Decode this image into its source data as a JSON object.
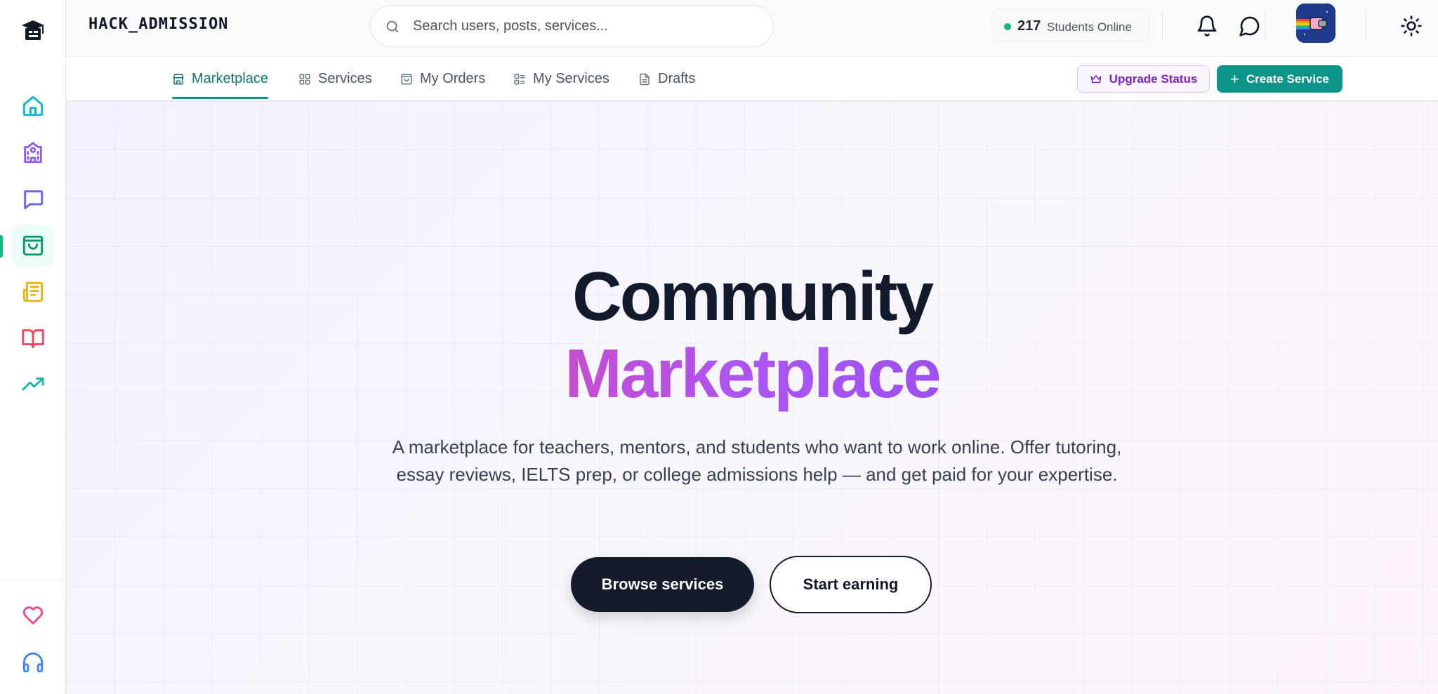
{
  "brand": {
    "name": "HACK_ADMISSION",
    "logo_icon": "graduation-cap-logo"
  },
  "search": {
    "placeholder": "Search users, posts, services..."
  },
  "online": {
    "count": "217",
    "label": "Students Online",
    "status_color": "#10b981"
  },
  "header_icons": [
    "bell-icon",
    "chat-icon",
    "user-avatar",
    "sun-icon"
  ],
  "sidebar": {
    "items": [
      {
        "name": "home",
        "icon": "home-icon",
        "color": "#06b6d4",
        "active": false
      },
      {
        "name": "university",
        "icon": "university-icon",
        "color": "#8b5cf6",
        "active": false
      },
      {
        "name": "messages",
        "icon": "message-icon",
        "color": "#6366f1",
        "active": false
      },
      {
        "name": "marketplace",
        "icon": "shopping-bag-icon",
        "color": "#059669",
        "active": true
      },
      {
        "name": "news",
        "icon": "newspaper-icon",
        "color": "#eab308",
        "active": false
      },
      {
        "name": "library",
        "icon": "book-open-icon",
        "color": "#f43f5e",
        "active": false
      },
      {
        "name": "trends",
        "icon": "trending-up-icon",
        "color": "#14b8a6",
        "active": false
      }
    ],
    "bottom": [
      {
        "name": "favorites",
        "icon": "heart-icon",
        "color": "#ec4899"
      },
      {
        "name": "support",
        "icon": "headphones-icon",
        "color": "#3b82f6"
      }
    ]
  },
  "tabs": [
    {
      "label": "Marketplace",
      "icon": "store-icon",
      "active": true
    },
    {
      "label": "Services",
      "icon": "grid-icon",
      "active": false
    },
    {
      "label": "My Orders",
      "icon": "bag-icon",
      "active": false
    },
    {
      "label": "My Services",
      "icon": "list-icon",
      "active": false
    },
    {
      "label": "Drafts",
      "icon": "file-icon",
      "active": false
    }
  ],
  "actions": {
    "upgrade_label": "Upgrade Status",
    "create_label": "Create Service"
  },
  "hero": {
    "title_line1": "Community",
    "title_line2": "Marketplace",
    "description": "A marketplace for teachers, mentors, and students who want to work online. Offer tutoring, essay reviews, IELTS prep, or college admissions help — and get paid for your expertise.",
    "primary_cta": "Browse services",
    "secondary_cta": "Start earning"
  },
  "colors": {
    "accent": "#0d9488",
    "upgrade": "#7e22ce",
    "dark": "#141b2d",
    "title_gradient_start": "#c44ed0",
    "title_gradient_end": "#a955f7"
  }
}
